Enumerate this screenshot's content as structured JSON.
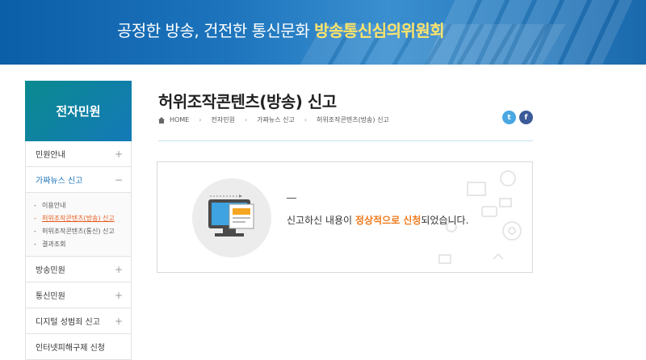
{
  "banner": {
    "slogan_plain": "공정한 방송, 건전한 통신문화 ",
    "slogan_bold": "방송통신심의위원회"
  },
  "sidebar": {
    "heading": "전자민원",
    "items": [
      {
        "label": "민원안내",
        "toggle": "+"
      },
      {
        "label": "가짜뉴스 신고",
        "toggle": "−"
      },
      {
        "label": "방송민원",
        "toggle": "+"
      },
      {
        "label": "통신민원",
        "toggle": "+"
      },
      {
        "label": "디지털 성범죄 신고",
        "toggle": "+"
      },
      {
        "label": "인터넷피해구제 신청",
        "toggle": ""
      }
    ],
    "subitems": [
      {
        "label": "이용안내"
      },
      {
        "label": "허위조작콘텐츠(방송) 신고"
      },
      {
        "label": "허위조작콘텐츠(통신) 신고"
      },
      {
        "label": "결과조회"
      }
    ]
  },
  "page": {
    "title": "허위조작콘텐츠(방송) 신고",
    "breadcrumb": [
      "HOME",
      "전자민원",
      "가짜뉴스 신고",
      "허위조작콘텐츠(방송) 신고"
    ],
    "social": {
      "twitter": "t",
      "facebook": "f"
    }
  },
  "result": {
    "text_before": "신고하신 내용이 ",
    "highlight": "정상적으로 신청",
    "text_after": "되었습니다."
  },
  "colors": {
    "brand_blue": "#1a73b8",
    "highlight_orange": "#f07a1c",
    "current_menu": "#e85b1c"
  }
}
